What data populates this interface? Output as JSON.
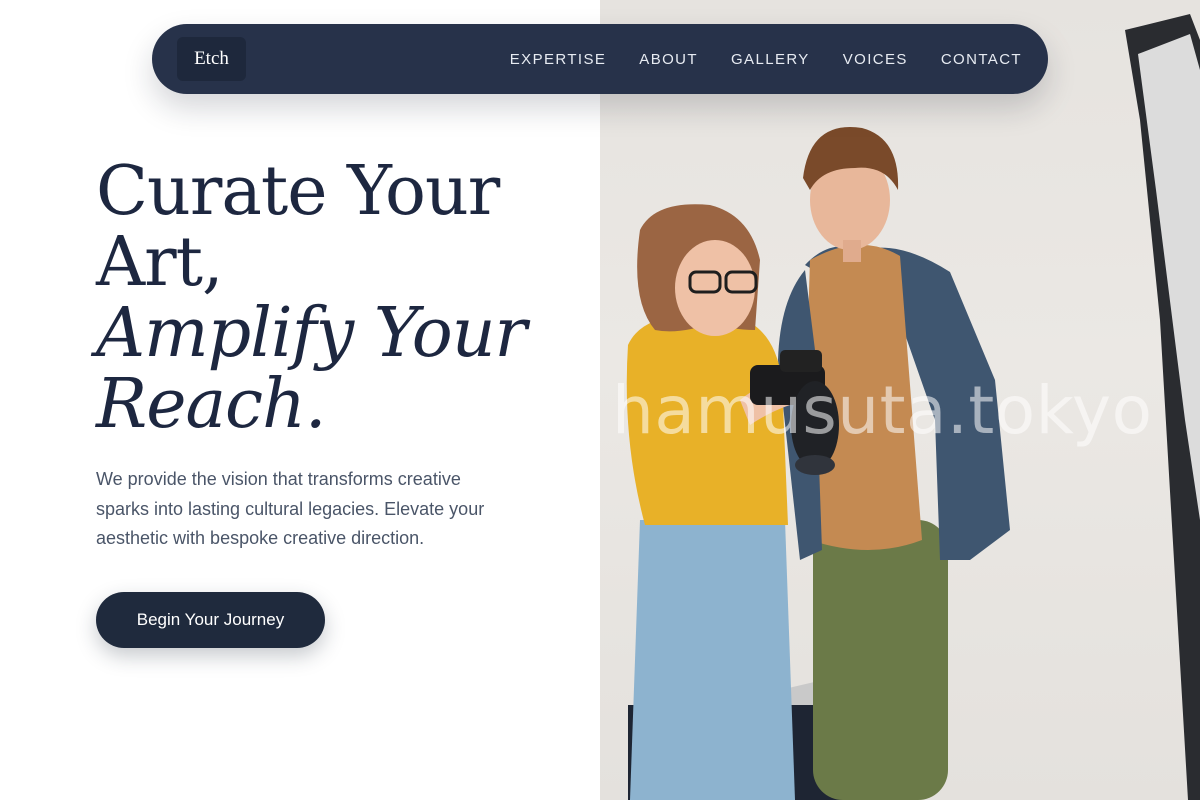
{
  "nav": {
    "brand": "Etch",
    "links": [
      "EXPERTISE",
      "ABOUT",
      "GALLERY",
      "VOICES",
      "CONTACT"
    ]
  },
  "hero": {
    "headline_line1": "Curate Your",
    "headline_line2": "Art,",
    "headline_line3": "Amplify Your",
    "headline_line4": "Reach.",
    "subtitle": "We provide the vision that transforms creative sparks into lasting cultural legacies. Elevate your aesthetic with bespoke creative direction.",
    "cta_label": "Begin Your Journey"
  },
  "photo": {
    "watermark": "hamusuta.tokyo"
  },
  "colors": {
    "navy": "#27324a",
    "button": "#1f2a3d",
    "text": "#1d2740",
    "muted": "#4a5568"
  }
}
